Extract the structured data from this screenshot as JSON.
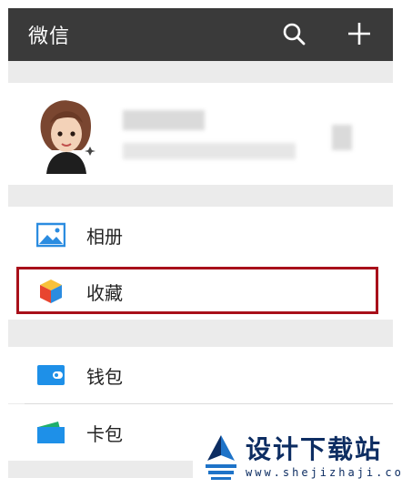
{
  "header": {
    "title": "微信",
    "search_icon": "search-icon",
    "add_icon": "plus-icon",
    "background": "#3a3a3a"
  },
  "profile": {
    "avatar_icon": "avatar",
    "name_blurred": true
  },
  "menu": {
    "items": [
      {
        "label": "相册",
        "icon": "photo-album-icon",
        "color": "#2b8ce0"
      },
      {
        "label": "收藏",
        "icon": "favorites-cube-icon",
        "color": "#f5a623",
        "highlighted": true
      },
      {
        "label": "钱包",
        "icon": "wallet-icon",
        "color": "#1e90e8"
      },
      {
        "label": "卡包",
        "icon": "card-wallet-icon",
        "color": "#1fae6b"
      }
    ]
  },
  "highlight_color": "#a8101a",
  "watermark": {
    "text": "设计下载站",
    "url": "www.shejizhaji.com"
  }
}
